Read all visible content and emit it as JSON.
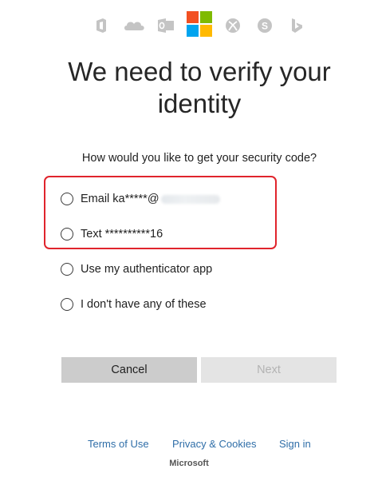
{
  "products": {
    "icons": [
      "office-icon",
      "onedrive-icon",
      "outlook-icon",
      "microsoft-logo",
      "xbox-icon",
      "skype-icon",
      "bing-icon"
    ],
    "logo_colors": {
      "red": "#f25022",
      "green": "#7fba00",
      "blue": "#00a4ef",
      "yellow": "#ffb900"
    },
    "icon_color": "#c4c4c4"
  },
  "main": {
    "title": "We need to verify your identity",
    "question": "How would you like to get your security code?"
  },
  "options": [
    {
      "label": "Email ka*****@"
    },
    {
      "label": "Text **********16"
    },
    {
      "label": "Use my authenticator app"
    },
    {
      "label": "I don't have any of these"
    }
  ],
  "highlight_color": "#e0242c",
  "buttons": {
    "cancel": "Cancel",
    "next": "Next"
  },
  "footer": {
    "terms": "Terms of Use",
    "privacy": "Privacy & Cookies",
    "signin": "Sign in",
    "brand": "Microsoft"
  },
  "link_color": "#2f6ea8"
}
